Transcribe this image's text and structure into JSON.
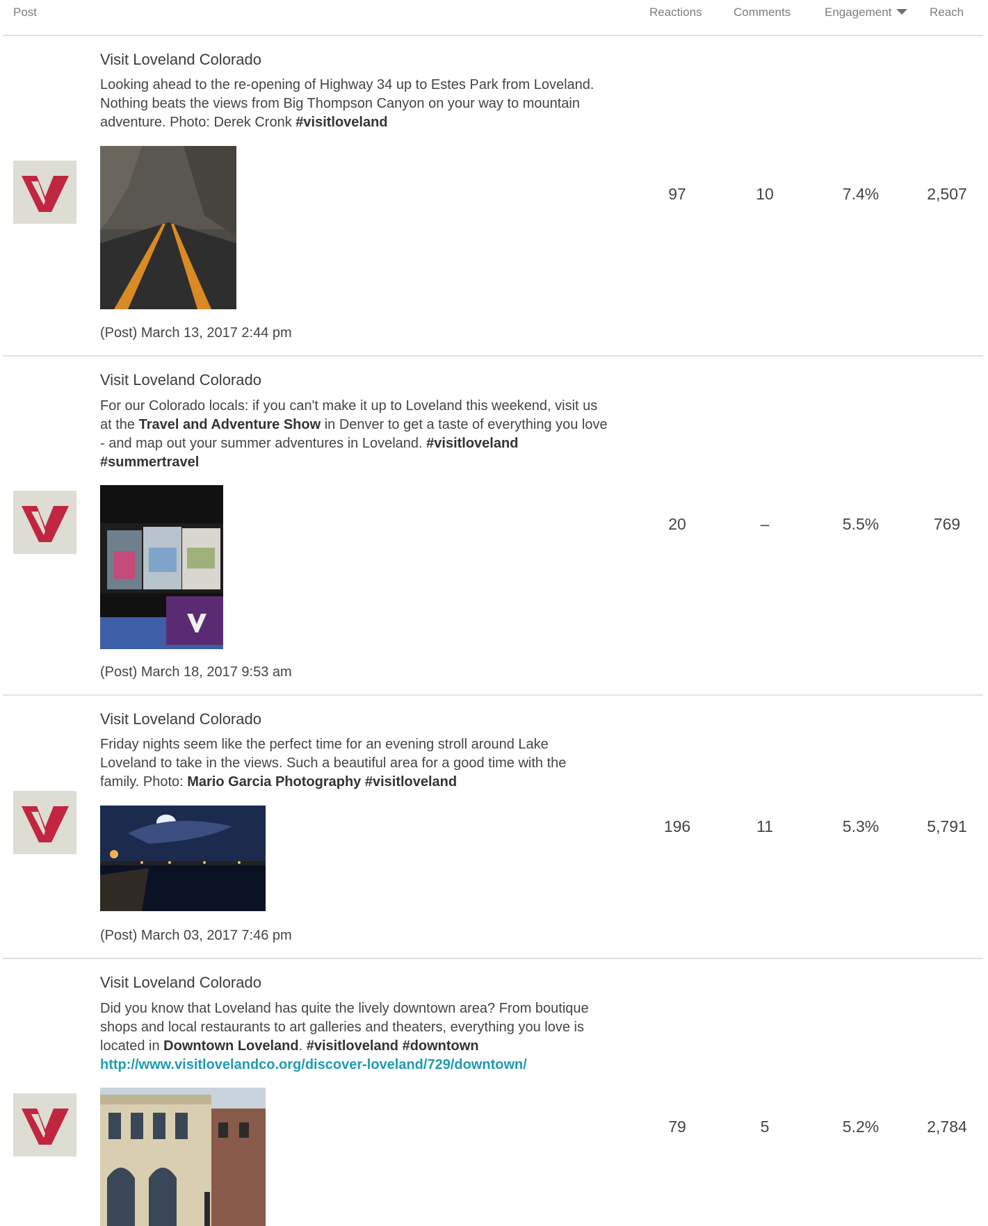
{
  "table": {
    "headers": {
      "post": "Post",
      "reactions": "Reactions",
      "comments": "Comments",
      "engagement": "Engagement",
      "reach": "Reach"
    },
    "sorted_by": "Engagement",
    "sort_direction": "descending"
  },
  "brand_color": "#c0263f",
  "link_color": "#1e9cb3",
  "posts": [
    {
      "author": "Visit Loveland Colorado",
      "text_parts": [
        "Looking ahead to the re-opening of Highway 34 up to Estes Park from Loveland. Nothing beats the views from Big Thompson Canyon on your way to mountain adventure. Photo: Derek Cronk ",
        "#visitloveland"
      ],
      "date": "(Post)  March 13, 2017 2:44 pm",
      "reactions": "97",
      "comments": "10",
      "engagement": "7.4%",
      "reach": "2,507"
    },
    {
      "author": "Visit Loveland Colorado",
      "text_parts": [
        "For our Colorado locals: if you can't make it up to Loveland this weekend, visit us at the ",
        "Travel and Adventure Show",
        " in Denver to get a taste of everything you love - and map out your summer adventures in Loveland. ",
        "#visitloveland #summertravel"
      ],
      "date": "(Post)  March 18, 2017 9:53 am",
      "reactions": "20",
      "comments": "–",
      "engagement": "5.5%",
      "reach": "769"
    },
    {
      "author": "Visit Loveland Colorado",
      "text_parts": [
        "Friday nights seem like the perfect time for an evening stroll around Lake Loveland to take in the views. Such a beautiful area for a good time with the family. Photo: ",
        "Mario Garcia Photography #visitloveland"
      ],
      "date": "(Post)  March 03, 2017 7:46 pm",
      "reactions": "196",
      "comments": "11",
      "engagement": "5.3%",
      "reach": "5,791"
    },
    {
      "author": "Visit Loveland Colorado",
      "text_parts": [
        "Did you know that Loveland has quite the lively downtown area? From boutique shops and local restaurants to art galleries and theaters, everything you love is located in ",
        "Downtown Loveland",
        ". ",
        "#visitloveland #downtown"
      ],
      "link": "http://www.visitlovelandco.org/discover-loveland/729/downtown/",
      "reactions": "79",
      "comments": "5",
      "engagement": "5.2%",
      "reach": "2,784"
    }
  ]
}
